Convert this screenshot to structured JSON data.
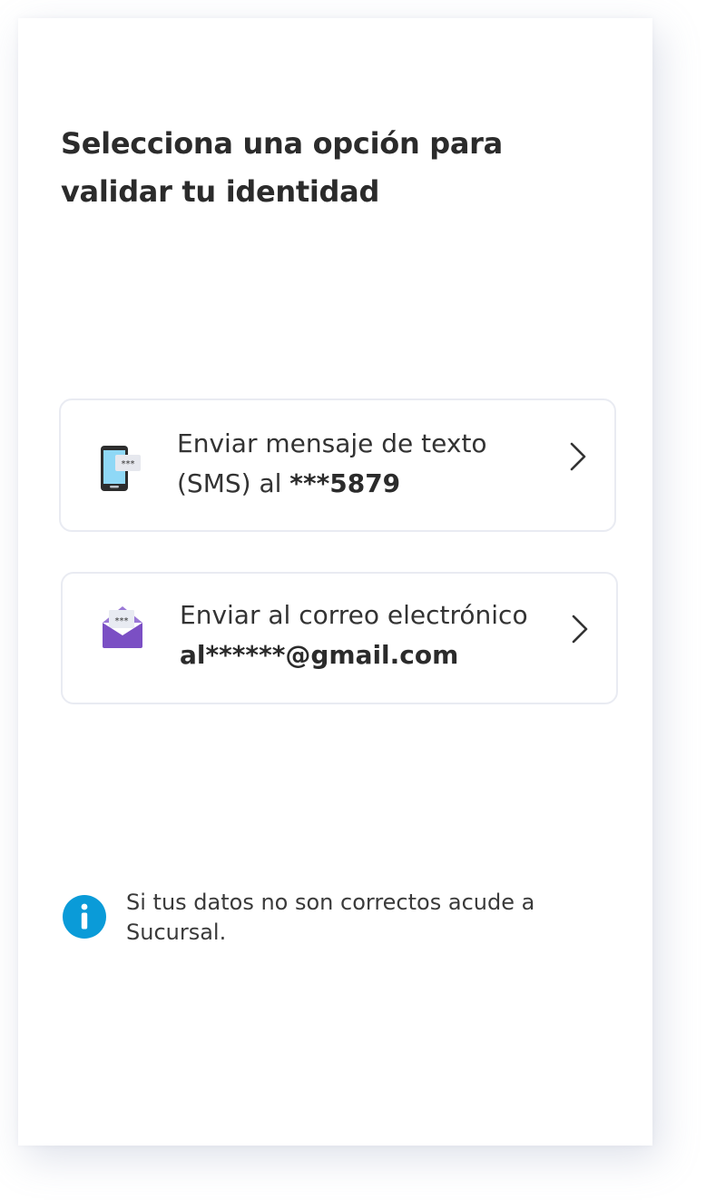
{
  "page": {
    "title": "Selecciona una opción para validar tu identidad"
  },
  "options": [
    {
      "icon": "phone-sms-icon",
      "line1": "Enviar mensaje de texto",
      "line2_prefix": "(SMS) al ",
      "line2_bold": "***5879"
    },
    {
      "icon": "envelope-icon",
      "line1": "Enviar al correo electrónico",
      "line2_bold": "al******@gmail.com"
    }
  ],
  "info": {
    "icon": "info-icon",
    "text": "Si tus datos no son correctos acude a Sucursal."
  },
  "colors": {
    "accent_purple": "#7b4fc4",
    "info_blue": "#0a9bd8",
    "phone_screen": "#8fd8f6",
    "text_dark": "#2b2b2b"
  }
}
